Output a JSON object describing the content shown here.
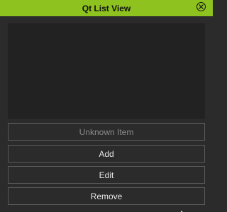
{
  "window": {
    "title": "Qt List View",
    "close_icon": "close-circle-icon",
    "accent_color": "#8ec21f"
  },
  "list": {
    "items": []
  },
  "buttons": {
    "unknown_item": "Unknown Item",
    "add": "Add",
    "edit": "Edit",
    "remove": "Remove"
  },
  "cursor_icon": "mouse-pointer-icon"
}
